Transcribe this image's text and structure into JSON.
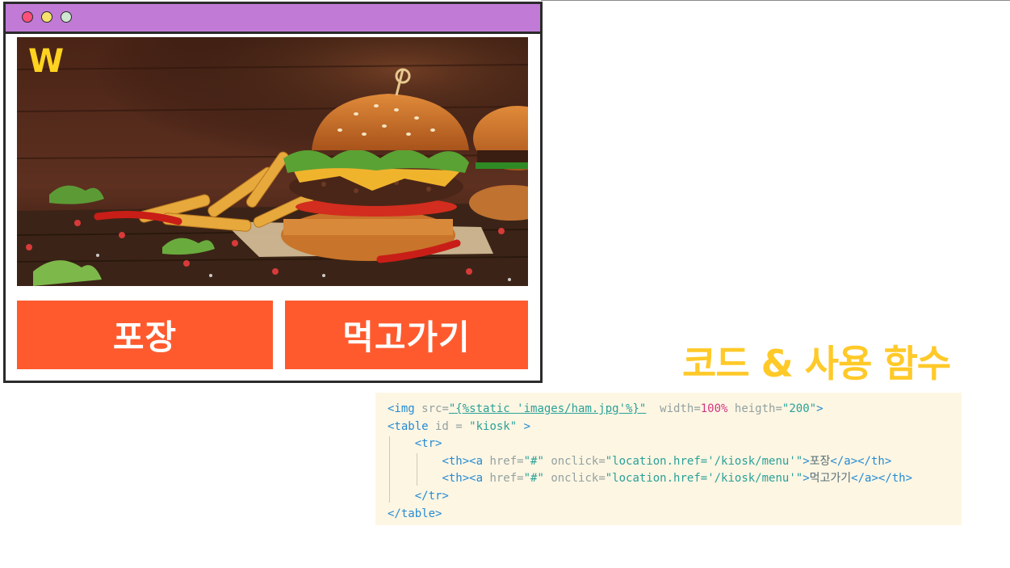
{
  "window": {
    "controls": [
      "close",
      "minimize",
      "maximize"
    ],
    "logo": "W",
    "hero_image": "burger-photo",
    "buttons": {
      "takeout": "포장",
      "eat_in": "먹고가기"
    }
  },
  "section_title": "코드 & 사용 함수",
  "code": {
    "line1": {
      "open": "<img",
      "src_attr": " src=",
      "src_val": "\"{%static 'images/ham.jpg'%}\"",
      "width_attr": "  width=",
      "width_val": "100%",
      "height_attr": " heigth=",
      "height_val": "\"200\"",
      "close": ">"
    },
    "line2": {
      "open": "<table",
      "id_attr": " id = ",
      "id_val": "\"kiosk\"",
      "close": " >"
    },
    "line3": "<tr>",
    "line4": {
      "th_a_open": "<th><a",
      "href_attr": " href=",
      "href_val": "\"#\"",
      "onclick_attr": " onclick=",
      "onclick_val1": "\"location.href=",
      "onclick_val2": "'/kiosk/menu'",
      "onclick_val3": "\"",
      "gt": ">",
      "text": "포장",
      "close": "</a></th>"
    },
    "line5": {
      "th_a_open": "<th><a",
      "href_attr": " href=",
      "href_val": "\"#\"",
      "onclick_attr": " onclick=",
      "onclick_val1": "\"location.href=",
      "onclick_val2": "'/kiosk/menu'",
      "onclick_val3": "\"",
      "gt": ">",
      "text": "먹고가기",
      "close": "</a></th>"
    },
    "line6": "</tr>",
    "line7": "</table>"
  },
  "colors": {
    "titlebar": "#c17bd6",
    "button": "#ff5a2e",
    "title": "#ffc928",
    "code_bg": "#fdf6e3",
    "logo": "#ffd21f"
  }
}
